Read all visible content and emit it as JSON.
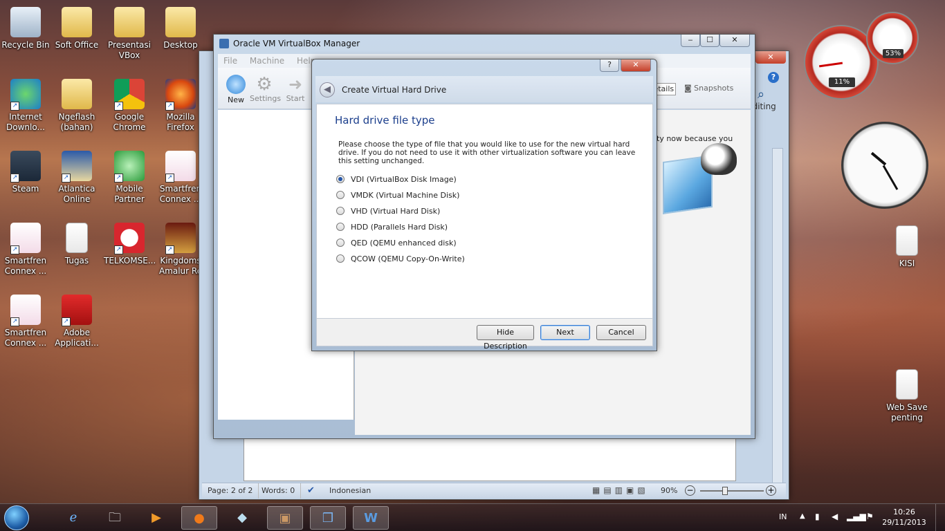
{
  "desktop": {
    "icons": [
      {
        "label": "Recycle Bin",
        "icon": "recycle-bin-icon"
      },
      {
        "label": "Soft Office",
        "icon": "folder-icon"
      },
      {
        "label": "Presentasi VBox",
        "icon": "folder-icon"
      },
      {
        "label": "Desktop",
        "icon": "folder-icon"
      },
      {
        "label": "Internet Downlo...",
        "icon": "download-manager-icon"
      },
      {
        "label": "Ngeflash (bahan)",
        "icon": "folder-icon"
      },
      {
        "label": "Google Chrome",
        "icon": "chrome-icon"
      },
      {
        "label": "Mozilla Firefox",
        "icon": "firefox-icon"
      },
      {
        "label": "Steam",
        "icon": "steam-icon"
      },
      {
        "label": "Atlantica Online",
        "icon": "atlantica-icon"
      },
      {
        "label": "Mobile Partner",
        "icon": "mobile-partner-icon"
      },
      {
        "label": "Smartfren Connex ...",
        "icon": "smartfren-icon"
      },
      {
        "label": "Smartfren Connex ...",
        "icon": "smartfren-icon"
      },
      {
        "label": "Tugas",
        "icon": "document-icon"
      },
      {
        "label": "TELKOMSE...",
        "icon": "telkomsel-icon"
      },
      {
        "label": "Kingdoms Amalur Re",
        "icon": "kingdoms-icon"
      },
      {
        "label": "Smartfren Connex ...",
        "icon": "smartfren-icon"
      },
      {
        "label": "Adobe Applicati...",
        "icon": "adobe-icon"
      },
      {
        "label": "KISI",
        "icon": "document-icon"
      },
      {
        "label": "Web Save penting",
        "icon": "document-icon"
      }
    ]
  },
  "gadgets": {
    "cpu_percent": "11%",
    "mem_percent": "53%"
  },
  "vbox": {
    "title": "Oracle VM VirtualBox Manager",
    "menu": [
      "File",
      "Machine",
      "Help"
    ],
    "toolbar": [
      "New",
      "Settings",
      "Start"
    ],
    "right_tabs": {
      "details": "Details",
      "snapshots": "Snapshots"
    },
    "welcome_fragment": "ty now because you"
  },
  "word": {
    "ribbon_editing": "Editing",
    "status": {
      "page": "Page: 2 of 2",
      "words": "Words: 0",
      "language": "Indonesian",
      "zoom": "90%"
    }
  },
  "dialog": {
    "help": "?",
    "close": "x",
    "back": "back",
    "title": "Create Virtual Hard Drive",
    "heading": "Hard drive file type",
    "description": "Please choose the type of file that you would like to use for the new virtual hard drive. If you do not need to use it with other virtualization software you can leave this setting unchanged.",
    "options": [
      {
        "label": "VDI (VirtualBox Disk Image)",
        "selected": true
      },
      {
        "label": "VMDK (Virtual Machine Disk)",
        "selected": false
      },
      {
        "label": "VHD (Virtual Hard Disk)",
        "selected": false
      },
      {
        "label": "HDD (Parallels Hard Disk)",
        "selected": false
      },
      {
        "label": "QED (QEMU enhanced disk)",
        "selected": false
      },
      {
        "label": "QCOW (QEMU Copy-On-Write)",
        "selected": false
      }
    ],
    "buttons": {
      "hide": "Hide Description",
      "next": "Next",
      "cancel": "Cancel"
    }
  },
  "taskbar": {
    "lang": "IN",
    "time": "10:26",
    "date": "29/11/2013"
  }
}
